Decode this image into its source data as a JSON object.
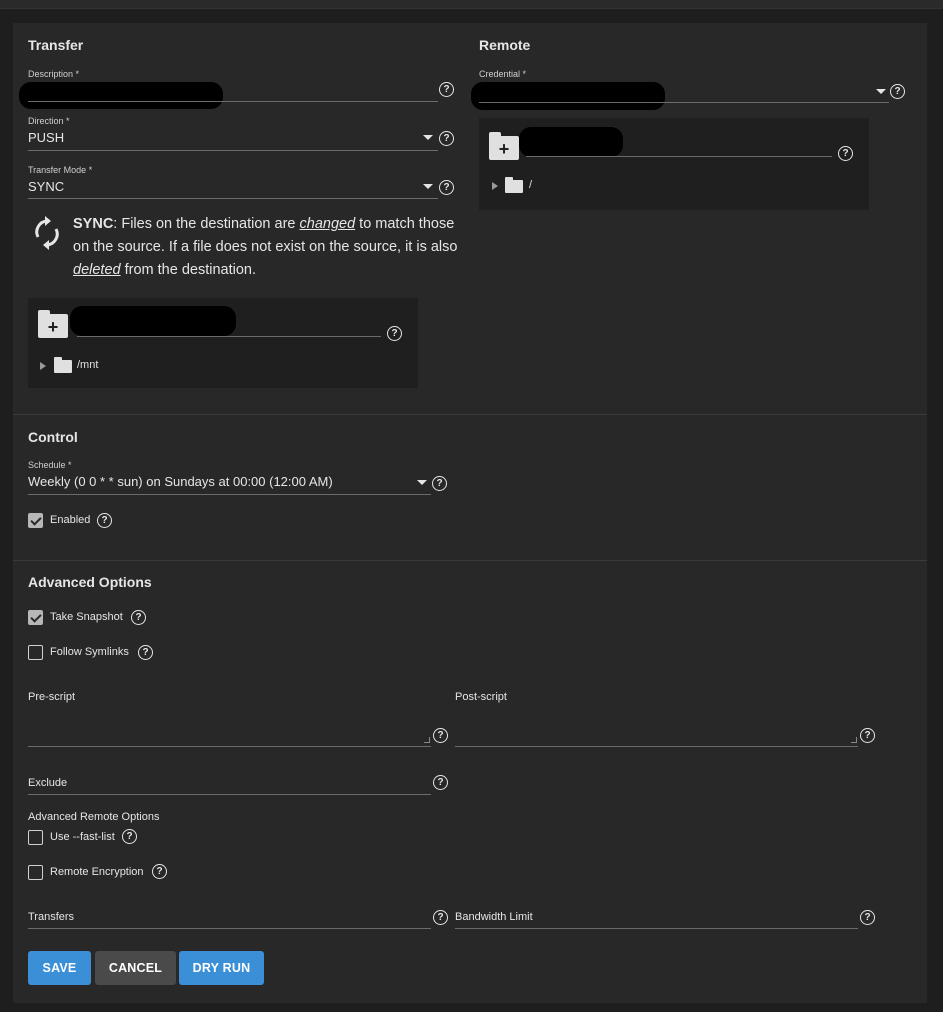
{
  "transfer": {
    "title": "Transfer",
    "description_label": "Description *",
    "direction_label": "Direction *",
    "direction_value": "PUSH",
    "mode_label": "Transfer Mode *",
    "mode_value": "SYNC",
    "mode_help": {
      "name": "SYNC",
      "part1": ": Files on the destination are ",
      "em1": "changed",
      "part2": " to match those on the source. If a file does not exist on the source, it is also ",
      "em2": "deleted",
      "part3": " from the destination."
    },
    "local_tree": {
      "root": "/mnt"
    }
  },
  "remote": {
    "title": "Remote",
    "credential_label": "Credential *",
    "tree": {
      "root": "/"
    }
  },
  "control": {
    "title": "Control",
    "schedule_label": "Schedule *",
    "schedule_value": "Weekly (0 0 * * sun) on Sundays at 00:00 (12:00 AM)",
    "enabled_label": "Enabled",
    "enabled_checked": true
  },
  "advanced": {
    "title": "Advanced Options",
    "take_snapshot_label": "Take Snapshot",
    "take_snapshot_checked": true,
    "follow_symlinks_label": "Follow Symlinks",
    "follow_symlinks_checked": false,
    "pre_script_label": "Pre-script",
    "post_script_label": "Post-script",
    "exclude_label": "Exclude",
    "remote_options_label": "Advanced Remote Options",
    "fast_list_label": "Use --fast-list",
    "fast_list_checked": false,
    "encryption_label": "Remote Encryption",
    "encryption_checked": false,
    "transfers_label": "Transfers",
    "bandwidth_label": "Bandwidth Limit"
  },
  "buttons": {
    "save": "SAVE",
    "cancel": "CANCEL",
    "dry_run": "DRY RUN"
  },
  "colors": {
    "background": "#1e1e1e",
    "card": "#282828",
    "primary": "#3b8fd6",
    "secondary": "#4a4a4a"
  },
  "icons": {
    "help": "question-circle-icon",
    "sync": "sync-icon",
    "folder_add": "create-folder-icon",
    "folder": "folder-icon"
  }
}
